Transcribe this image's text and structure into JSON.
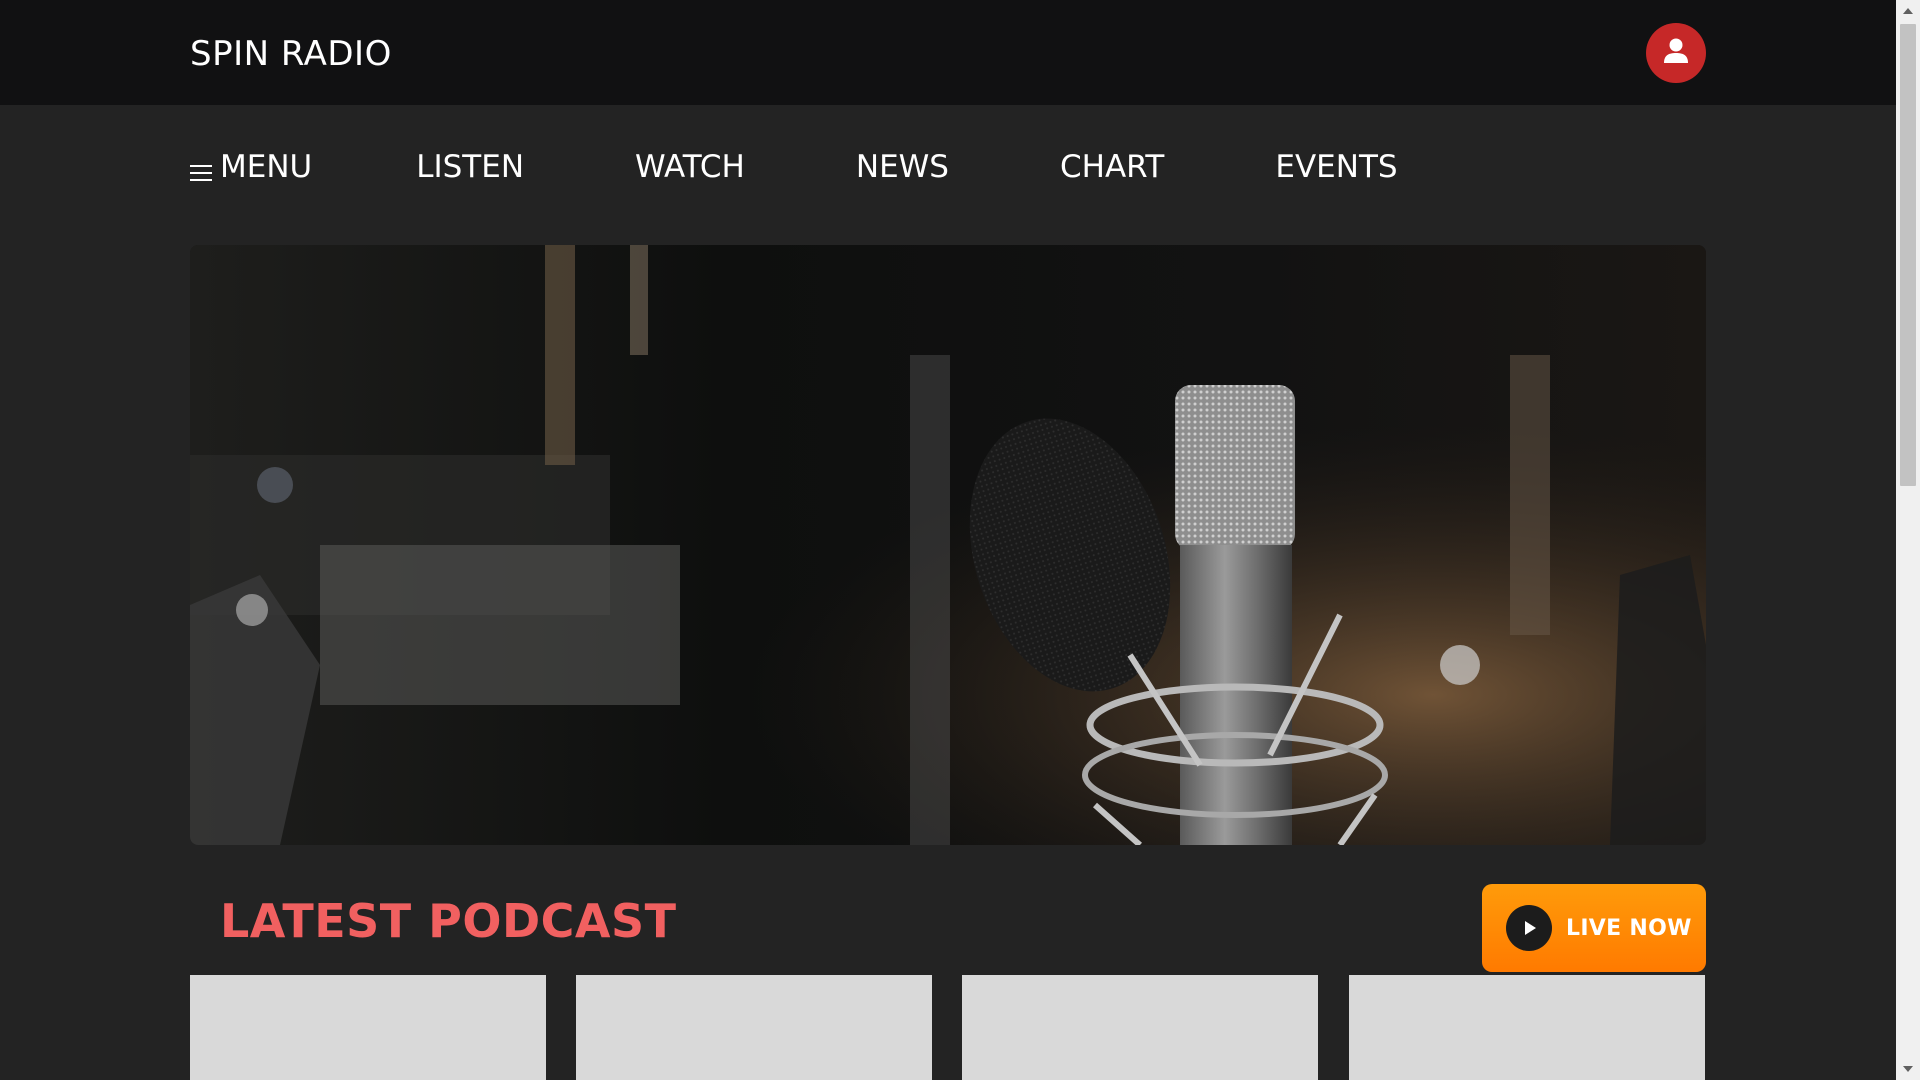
{
  "header": {
    "brand": "SPIN RADIO",
    "user_icon": "user-icon",
    "accent_color": "#c62828"
  },
  "nav": {
    "menu_label": "MENU",
    "menu_icon": "hamburger-icon",
    "items": [
      {
        "label": "LISTEN"
      },
      {
        "label": "WATCH"
      },
      {
        "label": "NEWS"
      },
      {
        "label": "CHART"
      },
      {
        "label": "EVENTS"
      }
    ]
  },
  "hero": {
    "image": "studio-microphone-photo"
  },
  "podcast": {
    "title": "LATEST PODCAST",
    "title_color": "#f16060",
    "live_button_label": "LIVE NOW",
    "live_button_icon": "play-icon",
    "live_button_color": "#ff8a00",
    "cards": [
      {},
      {},
      {},
      {}
    ]
  }
}
